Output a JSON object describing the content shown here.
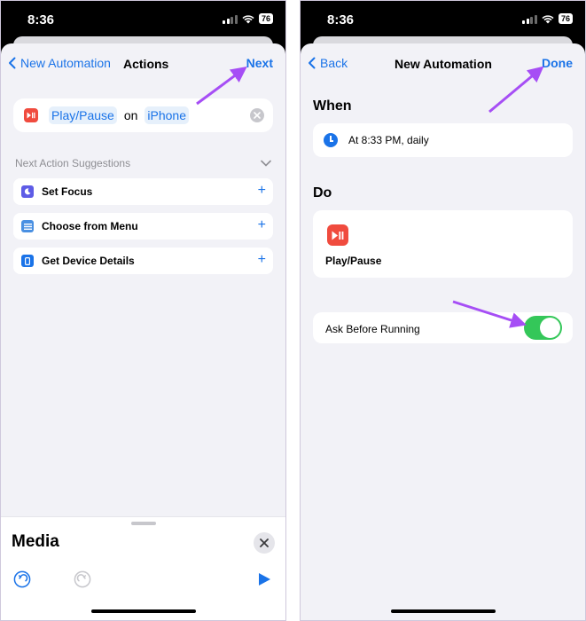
{
  "status_bar": {
    "time": "8:36",
    "battery": "76"
  },
  "left_screen": {
    "nav": {
      "back_label": "New Automation",
      "title": "Actions",
      "next_label": "Next"
    },
    "action": {
      "name": "Play/Pause",
      "connector": "on",
      "device": "iPhone"
    },
    "suggestions_header": "Next Action Suggestions",
    "suggestions": [
      {
        "label": "Set Focus",
        "icon": "moon-icon",
        "color": "#5e5ce6"
      },
      {
        "label": "Choose from Menu",
        "icon": "menu-icon",
        "color": "#4a90e2"
      },
      {
        "label": "Get Device Details",
        "icon": "phone-icon",
        "color": "#1a73e8"
      }
    ],
    "media_panel": {
      "title": "Media"
    }
  },
  "right_screen": {
    "nav": {
      "back_label": "Back",
      "title": "New Automation",
      "done_label": "Done"
    },
    "when": {
      "title": "When",
      "trigger": "At 8:33 PM, daily"
    },
    "do": {
      "title": "Do",
      "action": "Play/Pause"
    },
    "ask_before_running": {
      "label": "Ask Before Running",
      "enabled": true
    }
  },
  "colors": {
    "accent": "#1a73e8",
    "toggle_on": "#34c759",
    "play_pause": "#f04b3e",
    "arrow": "#a64ef5"
  }
}
